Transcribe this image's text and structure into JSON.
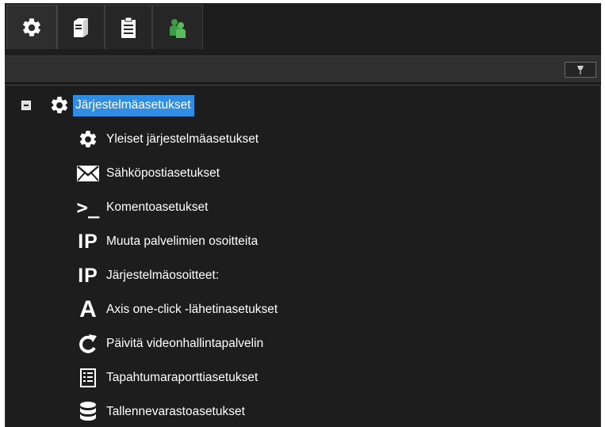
{
  "tabs": [
    {
      "icon": "gear-icon",
      "active": true
    },
    {
      "icon": "server-icon",
      "active": false
    },
    {
      "icon": "clipboard-icon",
      "active": false
    },
    {
      "icon": "users-icon",
      "active": false
    }
  ],
  "toolbar": {
    "pin_button_icon": "pin-icon"
  },
  "tree": {
    "root": {
      "label": "Järjestelmäasetukset",
      "icon": "gear-icon",
      "expanded": true,
      "selected": true
    },
    "items": [
      {
        "label": "Yleiset järjestelmäasetukset",
        "icon": "gear-icon"
      },
      {
        "label": "Sähköpostiasetukset",
        "icon": "envelope-icon"
      },
      {
        "label": "Komentoasetukset",
        "icon": "command-prompt-icon",
        "glyph": ">_"
      },
      {
        "label": "Muuta palvelimien osoitteita",
        "icon": "ip-icon",
        "glyph": "IP"
      },
      {
        "label": "Järjestelmäosoitteet:",
        "icon": "ip-icon",
        "glyph": "IP"
      },
      {
        "label": "Axis one-click -lähetinasetukset",
        "icon": "axis-icon",
        "glyph": "A"
      },
      {
        "label": "Päivitä videonhallintapalvelin",
        "icon": "refresh-icon"
      },
      {
        "label": "Tapahtumaraporttiasetukset",
        "icon": "report-list-icon"
      },
      {
        "label": "Tallennevarastoasetukset",
        "icon": "database-icon"
      }
    ]
  },
  "colors": {
    "background": "#1d1d1d",
    "selection": "#2f8de4",
    "users_icon": "#4caf50"
  }
}
